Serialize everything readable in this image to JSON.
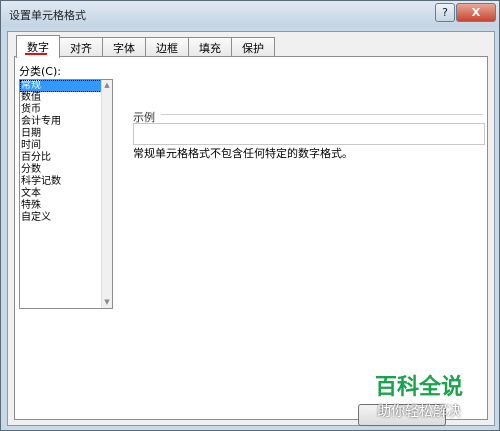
{
  "window": {
    "title": "设置单元格格式",
    "help_label": "?",
    "close_label": "X"
  },
  "tabs": [
    {
      "label": "数字"
    },
    {
      "label": "对齐"
    },
    {
      "label": "字体"
    },
    {
      "label": "边框"
    },
    {
      "label": "填充"
    },
    {
      "label": "保护"
    }
  ],
  "category": {
    "label": "分类(C):",
    "items": [
      "常规",
      "数值",
      "货币",
      "会计专用",
      "日期",
      "时间",
      "百分比",
      "分数",
      "科学记数",
      "文本",
      "特殊",
      "自定义"
    ],
    "selected": "常规"
  },
  "sample": {
    "label": "示例",
    "value": ""
  },
  "description": "常规单元格格式不包含任何特定的数字格式。",
  "watermark": {
    "top": "百科全说",
    "bottom": "助你轻松解决"
  },
  "colors": {
    "tab_underline": "#d11111",
    "selection": "#3399ff",
    "watermark_green": "#1aa34a"
  }
}
